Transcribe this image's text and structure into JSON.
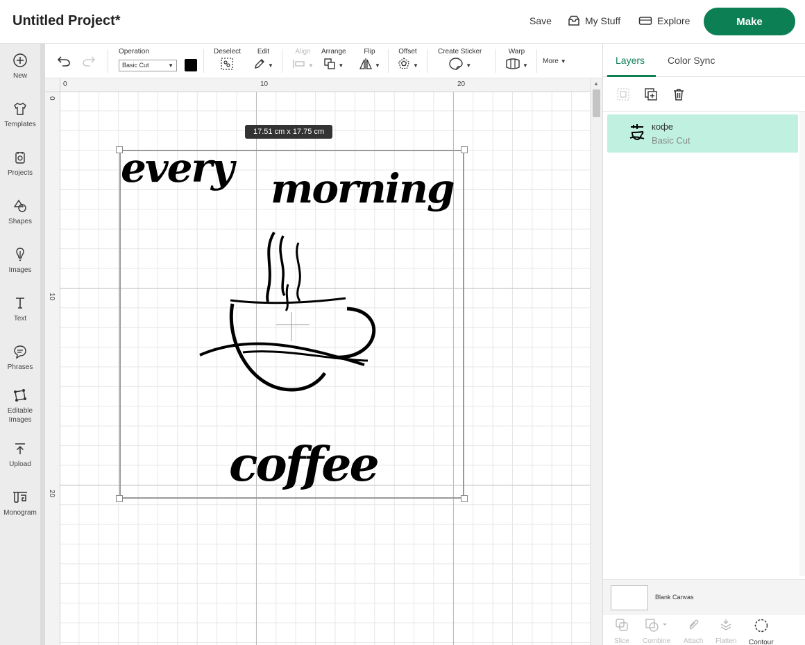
{
  "header": {
    "project_title": "Untitled Project*",
    "save_label": "Save",
    "mystuff_label": "My Stuff",
    "explore_label": "Explore",
    "make_label": "Make",
    "make_color": "#0c7f55"
  },
  "sidebar": {
    "items": [
      {
        "label": "New",
        "icon": "plus-circle-icon"
      },
      {
        "label": "Templates",
        "icon": "tshirt-icon"
      },
      {
        "label": "Projects",
        "icon": "projects-icon"
      },
      {
        "label": "Shapes",
        "icon": "shapes-icon"
      },
      {
        "label": "Images",
        "icon": "bulb-icon"
      },
      {
        "label": "Text",
        "icon": "text-icon"
      },
      {
        "label": "Phrases",
        "icon": "speech-bubble-icon"
      },
      {
        "label": "Editable Images",
        "icon": "editable-image-icon"
      },
      {
        "label": "Upload",
        "icon": "upload-icon"
      },
      {
        "label": "Monogram",
        "icon": "monogram-icon"
      }
    ]
  },
  "toolbar": {
    "operation_label": "Operation",
    "operation_value": "Basic Cut",
    "deselect_label": "Deselect",
    "edit_label": "Edit",
    "align_label": "Align",
    "arrange_label": "Arrange",
    "flip_label": "Flip",
    "offset_label": "Offset",
    "create_sticker_label": "Create Sticker",
    "warp_label": "Warp",
    "more_label": "More"
  },
  "canvas": {
    "ruler_top": [
      "0",
      "10",
      "20"
    ],
    "ruler_left": [
      "0",
      "10",
      "20"
    ],
    "size_badge": "17.51  cm x 17.75  cm",
    "design_words": [
      "every",
      "morning",
      "coffee"
    ]
  },
  "right_panel": {
    "tabs": [
      "Layers",
      "Color Sync"
    ],
    "layer_name": "кофе",
    "layer_operation": "Basic Cut",
    "blank_canvas_label": "Blank Canvas",
    "bottom_tools": [
      "Slice",
      "Combine",
      "Attach",
      "Flatten",
      "Contour"
    ]
  }
}
